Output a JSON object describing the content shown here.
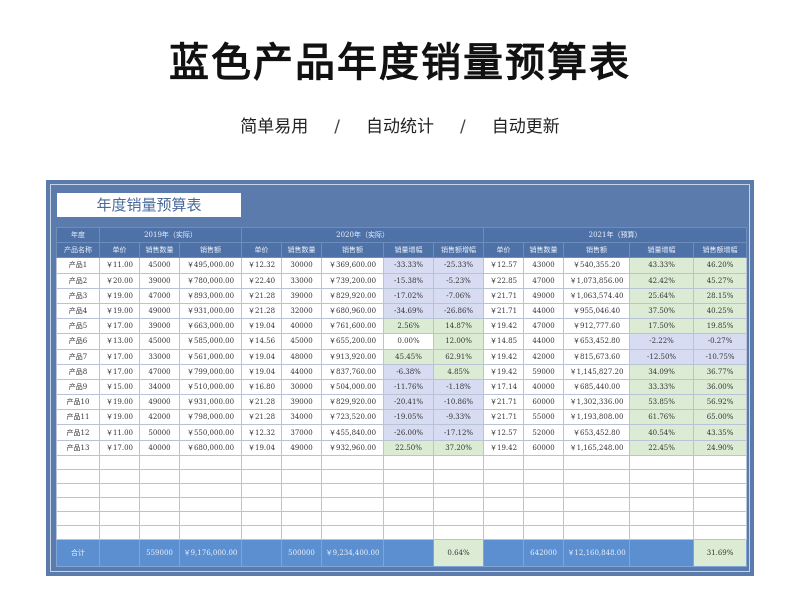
{
  "title": "蓝色产品年度销量预算表",
  "subtitle": [
    "简单易用",
    "自动统计",
    "自动更新"
  ],
  "sheet_title": "年度销量预算表",
  "header": {
    "year_label": "年度",
    "y2019": "2019年（实际）",
    "y2020": "2020年（实际）",
    "y2021": "2021年（预算）",
    "product": "产品名称",
    "price": "单价",
    "qty": "销售数量",
    "amount": "销售额",
    "qty_growth": "销量增幅",
    "amount_growth": "销售额增幅"
  },
  "rows": [
    {
      "name": "产品1",
      "p19": "￥11.00",
      "q19": "45000",
      "a19": "￥495,000.00",
      "p20": "￥12.32",
      "q20": "30000",
      "a20": "￥369,600.00",
      "qg20": "-33.33%",
      "ag20": "-25.33%",
      "p21": "￥12.57",
      "q21": "43000",
      "a21": "￥540,355.20",
      "qg21": "43.33%",
      "ag21": "46.20%"
    },
    {
      "name": "产品2",
      "p19": "￥20.00",
      "q19": "39000",
      "a19": "￥780,000.00",
      "p20": "￥22.40",
      "q20": "33000",
      "a20": "￥739,200.00",
      "qg20": "-15.38%",
      "ag20": "-5.23%",
      "p21": "￥22.85",
      "q21": "47000",
      "a21": "￥1,073,856.00",
      "qg21": "42.42%",
      "ag21": "45.27%"
    },
    {
      "name": "产品3",
      "p19": "￥19.00",
      "q19": "47000",
      "a19": "￥893,000.00",
      "p20": "￥21.28",
      "q20": "39000",
      "a20": "￥829,920.00",
      "qg20": "-17.02%",
      "ag20": "-7.06%",
      "p21": "￥21.71",
      "q21": "49000",
      "a21": "￥1,063,574.40",
      "qg21": "25.64%",
      "ag21": "28.15%"
    },
    {
      "name": "产品4",
      "p19": "￥19.00",
      "q19": "49000",
      "a19": "￥931,000.00",
      "p20": "￥21.28",
      "q20": "32000",
      "a20": "￥680,960.00",
      "qg20": "-34.69%",
      "ag20": "-26.86%",
      "p21": "￥21.71",
      "q21": "44000",
      "a21": "￥955,046.40",
      "qg21": "37.50%",
      "ag21": "40.25%"
    },
    {
      "name": "产品5",
      "p19": "￥17.00",
      "q19": "39000",
      "a19": "￥663,000.00",
      "p20": "￥19.04",
      "q20": "40000",
      "a20": "￥761,600.00",
      "qg20": "2.56%",
      "ag20": "14.87%",
      "p21": "￥19.42",
      "q21": "47000",
      "a21": "￥912,777.60",
      "qg21": "17.50%",
      "ag21": "19.85%"
    },
    {
      "name": "产品6",
      "p19": "￥13.00",
      "q19": "45000",
      "a19": "￥585,000.00",
      "p20": "￥14.56",
      "q20": "45000",
      "a20": "￥655,200.00",
      "qg20": "0.00%",
      "ag20": "12.00%",
      "p21": "￥14.85",
      "q21": "44000",
      "a21": "￥653,452.80",
      "qg21": "-2.22%",
      "ag21": "-0.27%"
    },
    {
      "name": "产品7",
      "p19": "￥17.00",
      "q19": "33000",
      "a19": "￥561,000.00",
      "p20": "￥19.04",
      "q20": "48000",
      "a20": "￥913,920.00",
      "qg20": "45.45%",
      "ag20": "62.91%",
      "p21": "￥19.42",
      "q21": "42000",
      "a21": "￥815,673.60",
      "qg21": "-12.50%",
      "ag21": "-10.75%"
    },
    {
      "name": "产品8",
      "p19": "￥17.00",
      "q19": "47000",
      "a19": "￥799,000.00",
      "p20": "￥19.04",
      "q20": "44000",
      "a20": "￥837,760.00",
      "qg20": "-6.38%",
      "ag20": "4.85%",
      "p21": "￥19.42",
      "q21": "59000",
      "a21": "￥1,145,827.20",
      "qg21": "34.09%",
      "ag21": "36.77%"
    },
    {
      "name": "产品9",
      "p19": "￥15.00",
      "q19": "34000",
      "a19": "￥510,000.00",
      "p20": "￥16.80",
      "q20": "30000",
      "a20": "￥504,000.00",
      "qg20": "-11.76%",
      "ag20": "-1.18%",
      "p21": "￥17.14",
      "q21": "40000",
      "a21": "￥685,440.00",
      "qg21": "33.33%",
      "ag21": "36.00%"
    },
    {
      "name": "产品10",
      "p19": "￥19.00",
      "q19": "49000",
      "a19": "￥931,000.00",
      "p20": "￥21.28",
      "q20": "39000",
      "a20": "￥829,920.00",
      "qg20": "-20.41%",
      "ag20": "-10.86%",
      "p21": "￥21.71",
      "q21": "60000",
      "a21": "￥1,302,336.00",
      "qg21": "53.85%",
      "ag21": "56.92%"
    },
    {
      "name": "产品11",
      "p19": "￥19.00",
      "q19": "42000",
      "a19": "￥798,000.00",
      "p20": "￥21.28",
      "q20": "34000",
      "a20": "￥723,520.00",
      "qg20": "-19.05%",
      "ag20": "-9.33%",
      "p21": "￥21.71",
      "q21": "55000",
      "a21": "￥1,193,808.00",
      "qg21": "61.76%",
      "ag21": "65.00%"
    },
    {
      "name": "产品12",
      "p19": "￥11.00",
      "q19": "50000",
      "a19": "￥550,000.00",
      "p20": "￥12.32",
      "q20": "37000",
      "a20": "￥455,840.00",
      "qg20": "-26.00%",
      "ag20": "-17.12%",
      "p21": "￥12.57",
      "q21": "52000",
      "a21": "￥653,452.80",
      "qg21": "40.54%",
      "ag21": "43.35%"
    },
    {
      "name": "产品13",
      "p19": "￥17.00",
      "q19": "40000",
      "a19": "￥680,000.00",
      "p20": "￥19.04",
      "q20": "49000",
      "a20": "￥932,960.00",
      "qg20": "22.50%",
      "ag20": "37.20%",
      "p21": "￥19.42",
      "q21": "60000",
      "a21": "￥1,165,248.00",
      "qg21": "22.45%",
      "ag21": "24.90%"
    }
  ],
  "total": {
    "label": "合计",
    "q19": "559000",
    "a19": "￥9,176,000.00",
    "q20": "500000",
    "a20": "￥9,234,400.00",
    "ag20": "0.64%",
    "q21": "642000",
    "a21": "￥12,160,848.00",
    "ag21": "31.69%"
  },
  "colors": {
    "frame": "#5a7bab",
    "header": "#4e72a8",
    "total": "#5b8fd0",
    "negative_highlight": "#d7dcf2",
    "positive_highlight": "#dcecd4"
  }
}
